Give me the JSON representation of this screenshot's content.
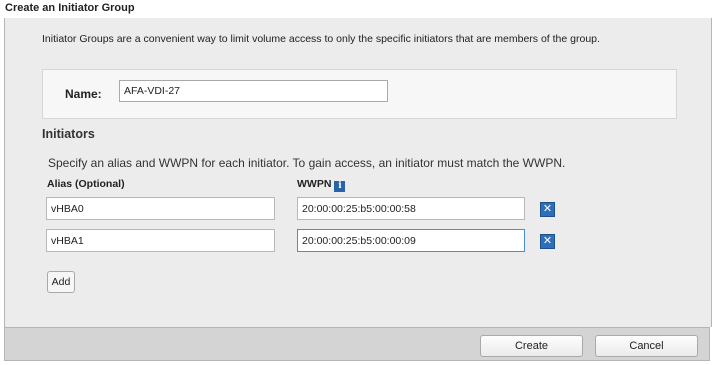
{
  "dialog": {
    "title": "Create an Initiator Group",
    "description": "Initiator Groups are a convenient way to limit volume access to only the specific initiators that are members of the group."
  },
  "name_field": {
    "label": "Name:",
    "value": "AFA-VDI-27"
  },
  "initiators": {
    "heading": "Initiators",
    "instructions": "Specify an alias and WWPN for each initiator. To gain access, an initiator must match the WWPN.",
    "alias_header": "Alias (Optional)",
    "wwpn_header": "WWPN",
    "info_icon": "info-icon",
    "rows": [
      {
        "alias": "vHBA0",
        "wwpn": "20:00:00:25:b5:00:00:58"
      },
      {
        "alias": "vHBA1",
        "wwpn": "20:00:00:25:b5:00:00:09"
      }
    ],
    "remove_glyph": "✕",
    "add_label": "Add"
  },
  "footer": {
    "create_label": "Create",
    "cancel_label": "Cancel"
  },
  "colors": {
    "accent": "#2f6fb8",
    "panel_bg": "#ececec",
    "footer_bg": "#d4d4d4"
  }
}
